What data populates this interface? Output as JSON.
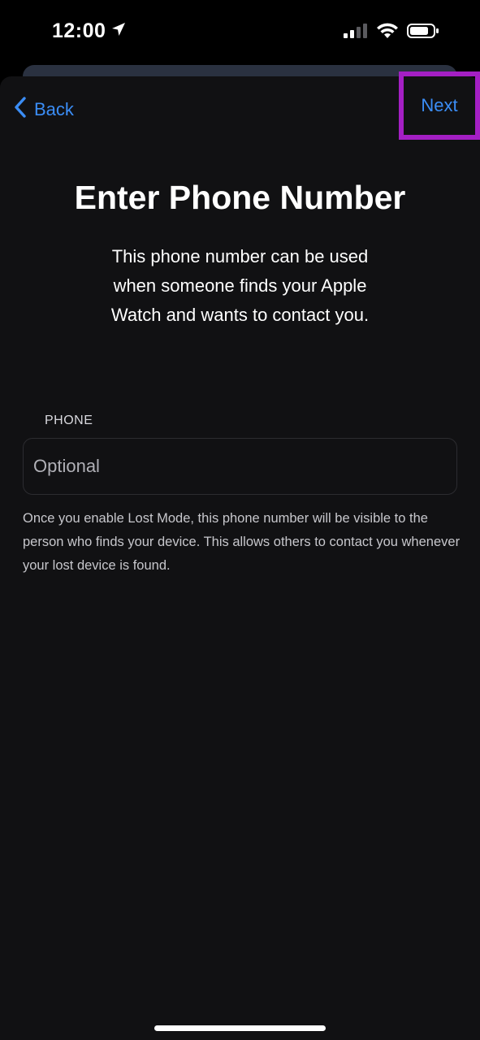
{
  "status_bar": {
    "time": "12:00"
  },
  "nav": {
    "back_label": "Back",
    "next_label": "Next"
  },
  "main": {
    "title": "Enter Phone Number",
    "subtitle": "This phone number can be used when someone finds your Apple Watch and wants to contact you.",
    "phone_section_label": "PHONE",
    "phone_placeholder": "Optional",
    "phone_value": "",
    "footnote": "Once you enable Lost Mode, this phone number will be visible to the person who finds your device. This allows others to contact you whenever your lost device is found."
  },
  "colors": {
    "accent": "#3b8df5",
    "highlight_border": "#a41fc4",
    "sheet_background": "#111113"
  },
  "icons": {
    "location": "location-arrow-icon",
    "signal": "cellular-signal-icon",
    "wifi": "wifi-icon",
    "battery": "battery-icon",
    "back": "chevron-left-icon"
  }
}
